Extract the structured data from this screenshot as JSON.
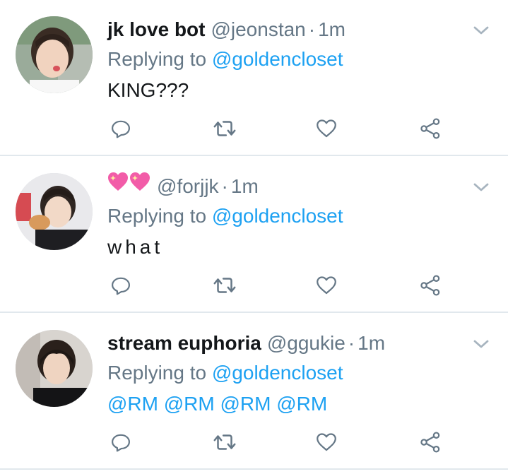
{
  "colors": {
    "text": "#14171a",
    "secondary": "#657786",
    "link": "#1da1f2",
    "divider": "#e1e8ed",
    "icon": "#657786"
  },
  "tweets": [
    {
      "display_name": "jk love bot",
      "display_name_emoji": "",
      "handle": "@jeonstan",
      "dot": "·",
      "time": "1m",
      "reply_label": "Replying to",
      "reply_target": "@goldencloset",
      "text": "KING???",
      "icons": [
        "reply-icon",
        "retweet-icon",
        "like-icon",
        "share-icon"
      ]
    },
    {
      "display_name": "",
      "display_name_emoji": "💖💖",
      "handle": "@forjjk",
      "dot": "·",
      "time": "1m",
      "reply_label": "Replying to",
      "reply_target": "@goldencloset",
      "text": "what",
      "icons": [
        "reply-icon",
        "retweet-icon",
        "like-icon",
        "share-icon"
      ]
    },
    {
      "display_name": "stream euphoria",
      "display_name_emoji": "",
      "handle": "@ggukie",
      "dot": "·",
      "time": "1m",
      "reply_label": "Replying to",
      "reply_target": "@goldencloset",
      "text": "@RM @RM @RM @RM",
      "icons": [
        "reply-icon",
        "retweet-icon",
        "like-icon",
        "share-icon"
      ]
    }
  ]
}
